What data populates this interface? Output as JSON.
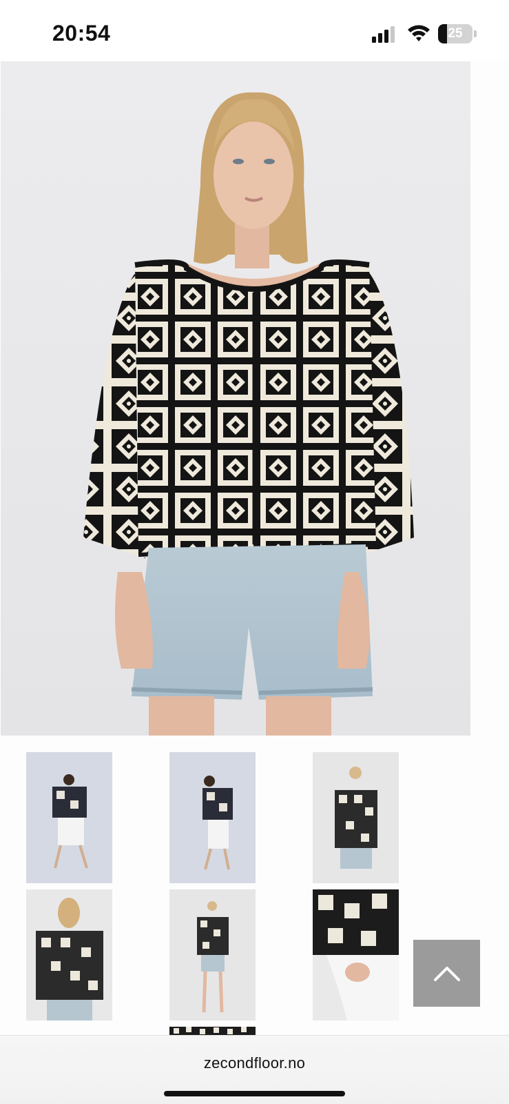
{
  "status_bar": {
    "time": "20:54",
    "battery_level": "25",
    "battery_fraction": 0.25,
    "signal_bars_active": 3,
    "icons": [
      "signal-icon",
      "wifi-icon",
      "battery-icon"
    ]
  },
  "product": {
    "main_image": {
      "icon": "product-photo",
      "garment_colors": {
        "black": "#121212",
        "cream": "#f1ecdf",
        "denim": "#b6c7d2"
      }
    },
    "thumbnails": [
      {
        "name": "thumbnail-1",
        "icon": "model-photo"
      },
      {
        "name": "thumbnail-2",
        "icon": "model-photo"
      },
      {
        "name": "thumbnail-3",
        "icon": "model-photo"
      },
      {
        "name": "thumbnail-4",
        "icon": "model-photo"
      },
      {
        "name": "thumbnail-5",
        "icon": "model-photo"
      },
      {
        "name": "thumbnail-6",
        "icon": "detail-photo"
      },
      {
        "name": "thumbnail-7",
        "icon": "detail-photo"
      }
    ]
  },
  "back_to_top": {
    "icon": "chevron-up-icon"
  },
  "browser": {
    "url": "zecondfloor.no"
  }
}
